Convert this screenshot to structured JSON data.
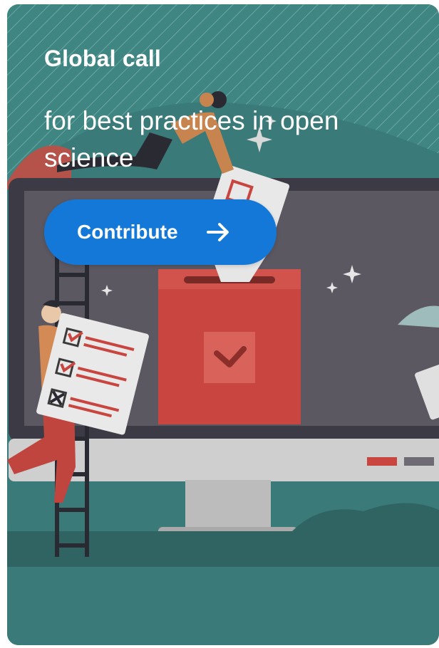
{
  "card": {
    "title": "Global call",
    "subtitle": "for best practices in open science",
    "cta_label": "Contribute",
    "cta_icon": "arrow-right-icon"
  },
  "colors": {
    "background_teal": "#3a7a78",
    "button_blue": "#1478d8",
    "monitor_dark": "#3c3a44",
    "screen_grey": "#5b5862",
    "ballot_red": "#c8463f"
  }
}
